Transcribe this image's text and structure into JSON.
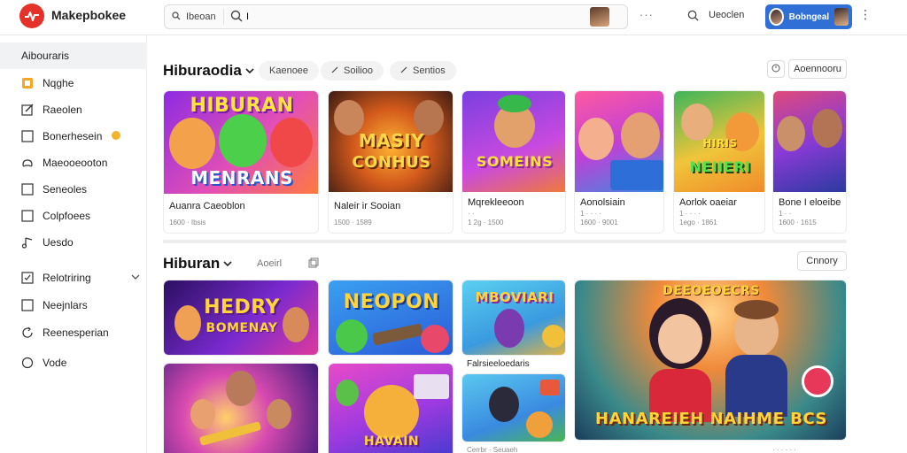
{
  "app": {
    "brand": "Makepbokee"
  },
  "search": {
    "scope_label": "Ibeoan",
    "value": "I",
    "placeholder": ""
  },
  "header": {
    "more": "···",
    "user_link": "Ueoclen",
    "profile_label": "Bobngeal",
    "kebab": "⋮"
  },
  "sidebar": {
    "heading": "Aibouraris",
    "items": [
      {
        "label": "Nqghe",
        "icon": "star-badge-icon"
      },
      {
        "label": "Raeolen",
        "icon": "edit-icon"
      },
      {
        "label": "Bonerhesein",
        "icon": "square-icon"
      },
      {
        "label": "Maeooeooton",
        "icon": "gamepad-icon"
      },
      {
        "label": "Seneoles",
        "icon": "square-icon"
      },
      {
        "label": "Colpfoees",
        "icon": "square-icon"
      },
      {
        "label": "Uesdo",
        "icon": "music-icon"
      },
      {
        "label": "Relotriring",
        "icon": "checklist-icon"
      },
      {
        "label": "Neejnlars",
        "icon": "square-icon"
      },
      {
        "label": "Reenesperian",
        "icon": "refresh-icon"
      },
      {
        "label": "Vode",
        "icon": "circle-icon"
      }
    ]
  },
  "section1": {
    "title": "Hiburaodia",
    "pills": [
      "Kaenoee",
      "Soilioo",
      "Sentios"
    ],
    "action": "Aoennooru"
  },
  "section2": {
    "title": "Hiburan",
    "ghost": "Aoeirl",
    "action": "Cnnory"
  },
  "row1_cards": [
    {
      "art": "HIBURAN",
      "art2": "MENRANS",
      "title": "Auanra Caeoblon",
      "meta": "1600 · Ibsis"
    },
    {
      "art": "MASIY",
      "art2": "CONHUS",
      "title": "Naleir ir Sooian",
      "meta": "1500 · 1589"
    },
    {
      "art": "SOMEINS",
      "art2": "",
      "title": "Mqrekleeoon",
      "meta": "· ·\n1 2g · 1500"
    },
    {
      "art": "",
      "art2": "",
      "title": "Aonolsiain",
      "meta": "1 · · · ·\n1600 · 9001"
    },
    {
      "art": "HIRIS",
      "art2": "NEIIERI",
      "title": "Aorlok oaeiar",
      "meta": "1 · · · ·\n1ego · 1861"
    },
    {
      "art": "",
      "art2": "",
      "title": "Bone I eloeibe",
      "meta": "1 · ·\n1600 · 1615"
    }
  ],
  "row2_cards": [
    {
      "art": "HEDRY",
      "art2": "BOMENAY"
    },
    {
      "art": "NEOPON",
      "art2": ""
    },
    {
      "art": "MBOVIARI",
      "art2": "",
      "title": "Falrsieeloedaris"
    },
    {
      "art": "DEEOEOECRS",
      "art2": "HANAREIEH NAIHME BCS"
    },
    {
      "art": "",
      "art2": ""
    },
    {
      "art": "HAVAIN",
      "art2": ""
    },
    {
      "art": "",
      "art2": ""
    }
  ],
  "bottom_meta": [
    "Cerrbr · Seuaeh",
    "· · · · · ·"
  ]
}
